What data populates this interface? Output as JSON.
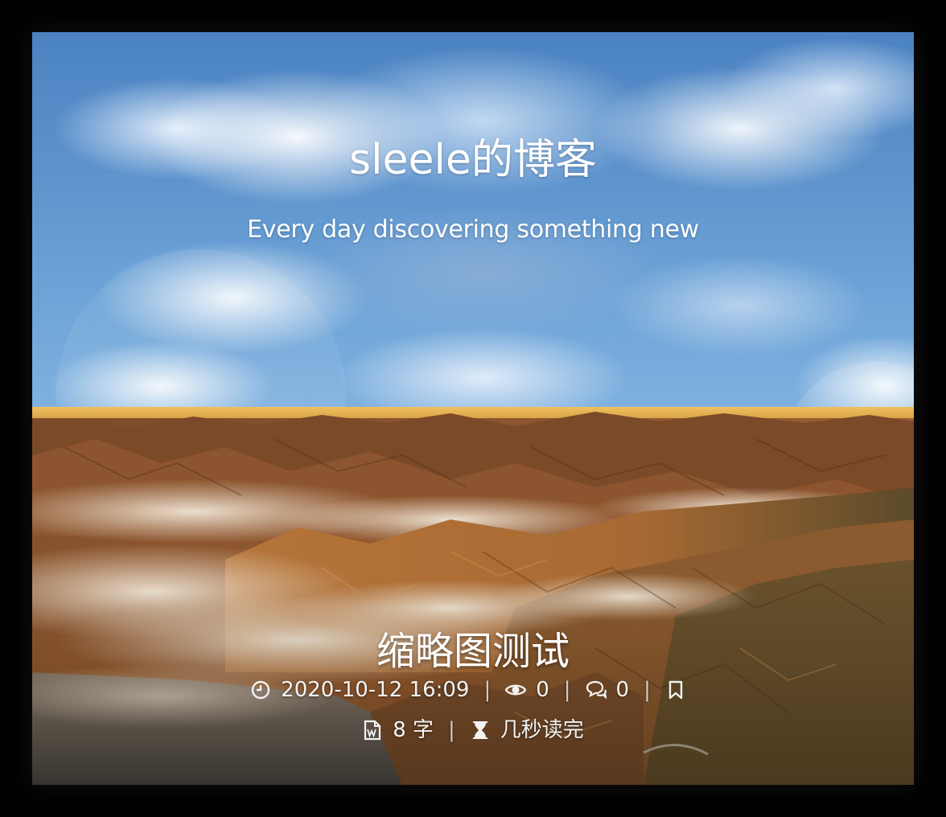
{
  "header": {
    "site_title": "sleele的博客",
    "site_subtitle": "Every day discovering something new"
  },
  "post": {
    "title": "缩略图测试",
    "meta": {
      "date": "2020-10-12 16:09",
      "views": "0",
      "comments": "0",
      "word_count": "8 字",
      "read_time": "几秒读完",
      "separator": "|"
    },
    "icons": [
      "clock-icon",
      "eye-icon",
      "comments-icon",
      "bookmark-icon",
      "word-doc-icon",
      "hourglass-icon"
    ]
  }
}
